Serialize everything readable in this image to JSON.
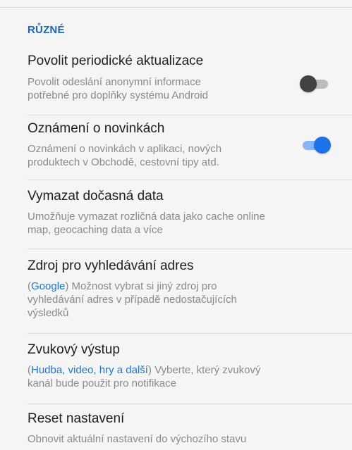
{
  "colors": {
    "accent": "#1a73e8",
    "header": "#1a64c7",
    "toggle_off_track": "#bdbdbd",
    "toggle_off_knob": "#424242",
    "toggle_on_track": "#8ab4f8",
    "toggle_on_knob": "#1a73e8"
  },
  "section": {
    "title": "RŮZNÉ"
  },
  "settings": [
    {
      "title": "Povolit periodické aktualizace",
      "desc_line1": "Povolit odeslání anonymní informace",
      "desc_line2": "potřebné pro doplňky systému Android",
      "toggle": "off"
    },
    {
      "title": "Oznámení o novinkách",
      "desc_line1": "Oznámení o novinkách v aplikaci, nových",
      "desc_line2": "produktech v Obchodě, cestovní tipy atd.",
      "toggle": "on"
    },
    {
      "title": "Vymazat dočasná data",
      "desc_line1": "Umožňuje vymazat rozličná data jako cache online",
      "desc_line2": "map, geocaching data a více"
    },
    {
      "title": "Zdroj pro vyhledávání adres",
      "desc_open": "(",
      "desc_highlight": "Google",
      "desc_after": ") Možnost vybrat si jiný zdroj pro",
      "desc_line2": "vyhledávání adres v případě nedostačujících",
      "desc_line3": "výsledků"
    },
    {
      "title": "Zvukový výstup",
      "desc_open": "(",
      "desc_highlight": "Hudba, video, hry a další",
      "desc_after": ") Vyberte, který zvukový",
      "desc_line2": "kanál bude použit pro notifikace"
    },
    {
      "title": "Reset nastavení",
      "desc_line1": "Obnovit aktuální nastavení do výchozího stavu"
    }
  ]
}
